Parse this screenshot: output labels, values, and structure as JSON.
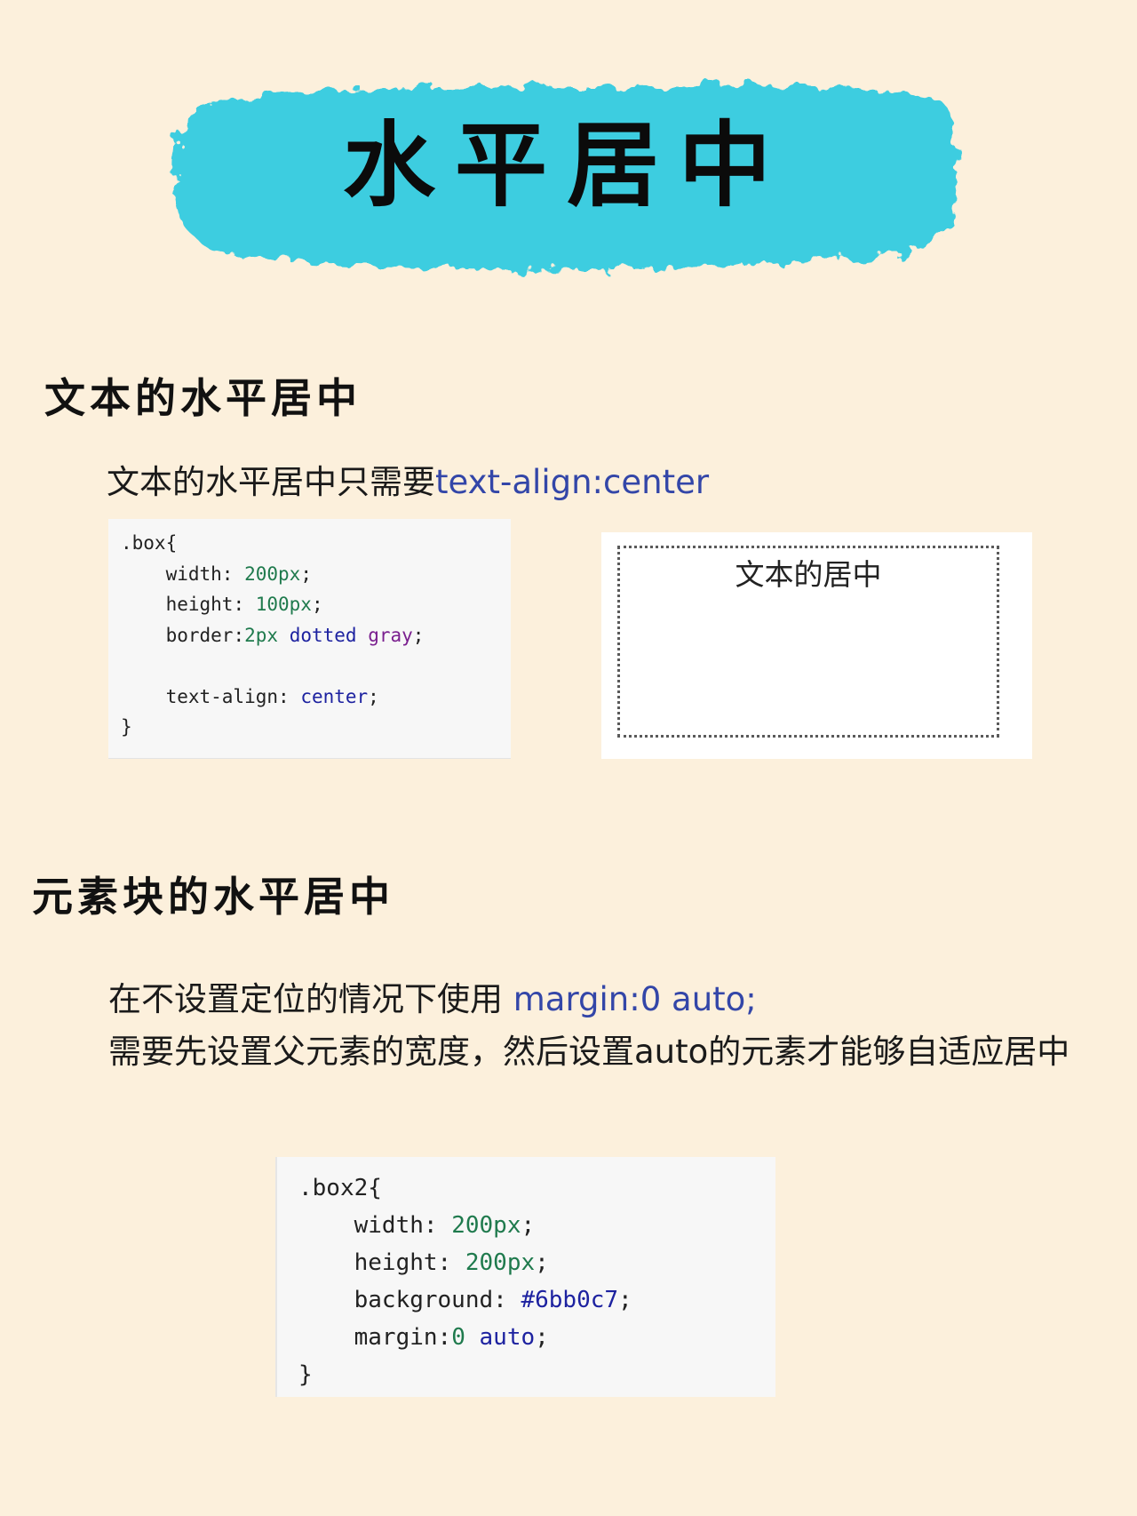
{
  "title": "水平居中",
  "colors": {
    "background": "#fcf0dc",
    "banner": "#3dcde0",
    "accent": "#3346a8",
    "code_bg": "#f7f7f7"
  },
  "section1": {
    "heading": "文本的水平居中",
    "description_plain": "文本的水平居中只需要",
    "description_code": "text-align:center",
    "code": [
      [
        {
          "t": ".box{",
          "c": "pun"
        }
      ],
      [
        {
          "t": "    width",
          "c": "prop"
        },
        {
          "t": ": ",
          "c": "pun"
        },
        {
          "t": "200px",
          "c": "num"
        },
        {
          "t": ";",
          "c": "pun"
        }
      ],
      [
        {
          "t": "    height",
          "c": "prop"
        },
        {
          "t": ": ",
          "c": "pun"
        },
        {
          "t": "100px",
          "c": "num"
        },
        {
          "t": ";",
          "c": "pun"
        }
      ],
      [
        {
          "t": "    border",
          "c": "prop"
        },
        {
          "t": ":",
          "c": "pun"
        },
        {
          "t": "2px",
          "c": "num"
        },
        {
          "t": " ",
          "c": "pun"
        },
        {
          "t": "dotted",
          "c": "kw"
        },
        {
          "t": " ",
          "c": "pun"
        },
        {
          "t": "gray",
          "c": "name"
        },
        {
          "t": ";",
          "c": "pun"
        }
      ],
      [
        {
          "t": "",
          "c": "pun"
        }
      ],
      [
        {
          "t": "    text-align",
          "c": "prop"
        },
        {
          "t": ": ",
          "c": "pun"
        },
        {
          "t": "center",
          "c": "kw"
        },
        {
          "t": ";",
          "c": "pun"
        }
      ],
      [
        {
          "t": "}",
          "c": "pun"
        }
      ]
    ],
    "demo_text": "文本的居中"
  },
  "section2": {
    "heading": "元素块的水平居中",
    "line1_plain": "在不设置定位的情况下使用 ",
    "line1_code": "margin:0 auto;",
    "line2_a": "需要先设置父元素的宽度，然后设置",
    "line2_b": "auto",
    "line2_c": "的元素才能够自适应居中",
    "code": [
      [
        {
          "t": ".box2{",
          "c": "pun"
        }
      ],
      [
        {
          "t": "    width",
          "c": "prop"
        },
        {
          "t": ": ",
          "c": "pun"
        },
        {
          "t": "200px",
          "c": "num"
        },
        {
          "t": ";",
          "c": "pun"
        }
      ],
      [
        {
          "t": "    height",
          "c": "prop"
        },
        {
          "t": ": ",
          "c": "pun"
        },
        {
          "t": "200px",
          "c": "num"
        },
        {
          "t": ";",
          "c": "pun"
        }
      ],
      [
        {
          "t": "    background",
          "c": "prop"
        },
        {
          "t": ": ",
          "c": "pun"
        },
        {
          "t": "#6bb0c7",
          "c": "hex"
        },
        {
          "t": ";",
          "c": "pun"
        }
      ],
      [
        {
          "t": "    margin",
          "c": "prop"
        },
        {
          "t": ":",
          "c": "pun"
        },
        {
          "t": "0",
          "c": "num"
        },
        {
          "t": " ",
          "c": "pun"
        },
        {
          "t": "auto",
          "c": "kw"
        },
        {
          "t": ";",
          "c": "pun"
        }
      ],
      [
        {
          "t": "}",
          "c": "pun"
        }
      ]
    ]
  }
}
